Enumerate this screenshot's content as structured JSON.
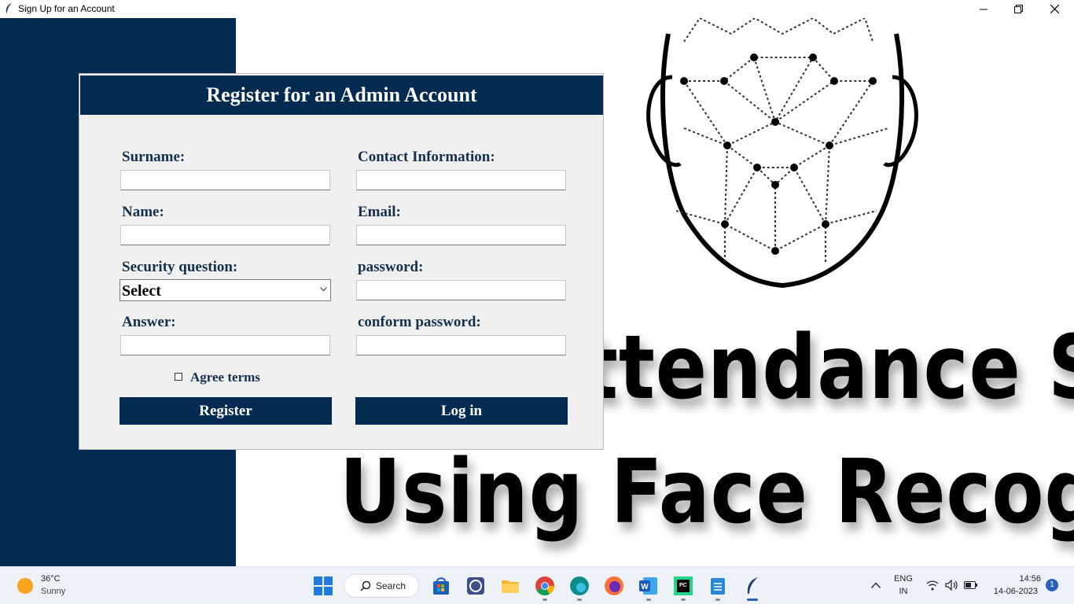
{
  "window": {
    "title": "Sign Up for an Account"
  },
  "background": {
    "line1": "ttendance Sy",
    "line2": "Using Face Recognit"
  },
  "form": {
    "title": "Register for an Admin Account",
    "surname_label": "Surname:",
    "surname_value": "",
    "contact_label": "Contact Information:",
    "contact_value": "",
    "name_label": "Name:",
    "name_value": "",
    "email_label": "Email:",
    "email_value": "",
    "security_label": "Security question:",
    "security_selected": "Select",
    "password_label": "password:",
    "password_value": "",
    "answer_label": "Answer:",
    "answer_value": "",
    "confirm_label": "conform password:",
    "confirm_value": "",
    "agree_label": "Agree terms",
    "agree_checked": false,
    "register_label": "Register",
    "login_label": "Log in"
  },
  "taskbar": {
    "weather_temp": "36°C",
    "weather_desc": "Sunny",
    "search_label": "Search",
    "lang_line1": "ENG",
    "lang_line2": "IN",
    "time": "14:56",
    "date": "14-06-2023",
    "notification_count": "1",
    "apps": [
      "start-icon",
      "search-icon",
      "store-icon",
      "app-icon",
      "file-explorer-icon",
      "chrome-icon",
      "edge-icon",
      "firefox-icon",
      "word-icon",
      "pycharm-icon",
      "notepad-icon",
      "feather-app-icon"
    ]
  },
  "colors": {
    "brand_navy": "#032b52",
    "label_text": "#14304f",
    "form_bg": "#f0f0f0"
  }
}
